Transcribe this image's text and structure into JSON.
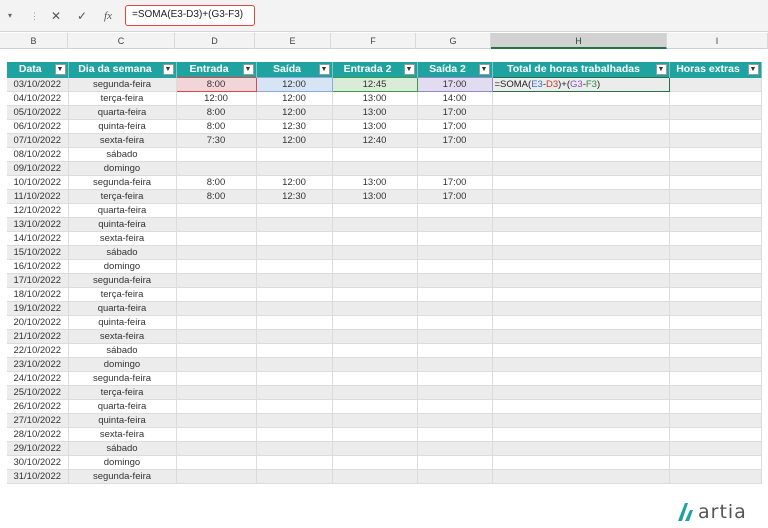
{
  "formula_bar": {
    "namebox_arrow": "▾",
    "grip": "⋮",
    "cancel_glyph": "✕",
    "enter_glyph": "✓",
    "insert_glyph": "fx",
    "formula": "=SOMA(E3-D3)+(G3-F3)"
  },
  "columns": [
    "B",
    "C",
    "D",
    "E",
    "F",
    "G",
    "H",
    "I"
  ],
  "selected_column": "H",
  "table": {
    "headers": [
      "Data",
      "Dia da semana",
      "Entrada",
      "Saída",
      "Entrada 2",
      "Saída 2",
      "Total de horas trabalhadas",
      "Horas extras"
    ],
    "header_color": "#1fa3a1",
    "filter_glyph": "▼",
    "rows": [
      [
        "03/10/2022",
        "segunda-feira",
        "8:00",
        "12:00",
        "12:45",
        "17:00",
        "",
        ""
      ],
      [
        "04/10/2022",
        "terça-feira",
        "12:00",
        "12:00",
        "13:00",
        "14:00",
        "",
        ""
      ],
      [
        "05/10/2022",
        "quarta-feira",
        "8:00",
        "12:00",
        "13:00",
        "17:00",
        "",
        ""
      ],
      [
        "06/10/2022",
        "quinta-feira",
        "8:00",
        "12:30",
        "13:00",
        "17:00",
        "",
        ""
      ],
      [
        "07/10/2022",
        "sexta-feira",
        "7:30",
        "12:00",
        "12:40",
        "17:00",
        "",
        ""
      ],
      [
        "08/10/2022",
        "sábado",
        "",
        "",
        "",
        "",
        "",
        ""
      ],
      [
        "09/10/2022",
        "domingo",
        "",
        "",
        "",
        "",
        "",
        ""
      ],
      [
        "10/10/2022",
        "segunda-feira",
        "8:00",
        "12:00",
        "13:00",
        "17:00",
        "",
        ""
      ],
      [
        "11/10/2022",
        "terça-feira",
        "8:00",
        "12:30",
        "13:00",
        "17:00",
        "",
        ""
      ],
      [
        "12/10/2022",
        "quarta-feira",
        "",
        "",
        "",
        "",
        "",
        ""
      ],
      [
        "13/10/2022",
        "quinta-feira",
        "",
        "",
        "",
        "",
        "",
        ""
      ],
      [
        "14/10/2022",
        "sexta-feira",
        "",
        "",
        "",
        "",
        "",
        ""
      ],
      [
        "15/10/2022",
        "sábado",
        "",
        "",
        "",
        "",
        "",
        ""
      ],
      [
        "16/10/2022",
        "domingo",
        "",
        "",
        "",
        "",
        "",
        ""
      ],
      [
        "17/10/2022",
        "segunda-feira",
        "",
        "",
        "",
        "",
        "",
        ""
      ],
      [
        "18/10/2022",
        "terça-feira",
        "",
        "",
        "",
        "",
        "",
        ""
      ],
      [
        "19/10/2022",
        "quarta-feira",
        "",
        "",
        "",
        "",
        "",
        ""
      ],
      [
        "20/10/2022",
        "quinta-feira",
        "",
        "",
        "",
        "",
        "",
        ""
      ],
      [
        "21/10/2022",
        "sexta-feira",
        "",
        "",
        "",
        "",
        "",
        ""
      ],
      [
        "22/10/2022",
        "sábado",
        "",
        "",
        "",
        "",
        "",
        ""
      ],
      [
        "23/10/2022",
        "domingo",
        "",
        "",
        "",
        "",
        "",
        ""
      ],
      [
        "24/10/2022",
        "segunda-feira",
        "",
        "",
        "",
        "",
        "",
        ""
      ],
      [
        "25/10/2022",
        "terça-feira",
        "",
        "",
        "",
        "",
        "",
        ""
      ],
      [
        "26/10/2022",
        "quarta-feira",
        "",
        "",
        "",
        "",
        "",
        ""
      ],
      [
        "27/10/2022",
        "quinta-feira",
        "",
        "",
        "",
        "",
        "",
        ""
      ],
      [
        "28/10/2022",
        "sexta-feira",
        "",
        "",
        "",
        "",
        "",
        ""
      ],
      [
        "29/10/2022",
        "sábado",
        "",
        "",
        "",
        "",
        "",
        ""
      ],
      [
        "30/10/2022",
        "domingo",
        "",
        "",
        "",
        "",
        "",
        ""
      ],
      [
        "31/10/2022",
        "segunda-feira",
        "",
        "",
        "",
        "",
        "",
        ""
      ]
    ],
    "editing_formula_parts": [
      {
        "text": "=SOMA(",
        "ref": "fp"
      },
      {
        "text": "E3",
        "ref": "fE"
      },
      {
        "text": "-",
        "ref": "fp"
      },
      {
        "text": "D3",
        "ref": "fD"
      },
      {
        "text": ")+(",
        "ref": "fp"
      },
      {
        "text": "G3",
        "ref": "fG"
      },
      {
        "text": "-",
        "ref": "fp"
      },
      {
        "text": "F3",
        "ref": "fF"
      },
      {
        "text": ")",
        "ref": "fp"
      }
    ]
  },
  "logo": {
    "text": "artia",
    "color": "#1fa3a1"
  }
}
